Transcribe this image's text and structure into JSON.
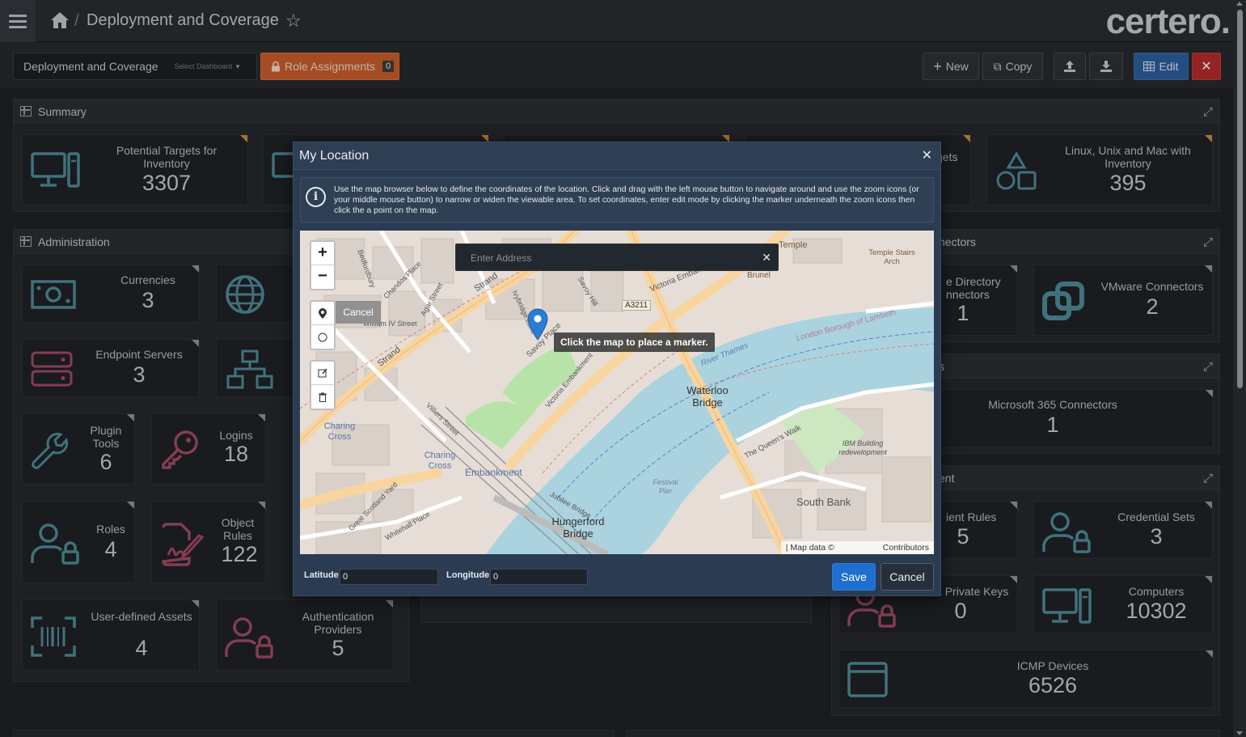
{
  "topbar": {
    "page_title": "Deployment and Coverage",
    "brand": "certero."
  },
  "toolbar": {
    "dashboard_name": "Deployment and Coverage",
    "dashboard_select": "Select Dashboard",
    "role_label": "Role Assignments",
    "role_count": "0",
    "new_label": "New",
    "copy_label": "Copy",
    "edit_label": "Edit",
    "close_label": "✕"
  },
  "summary": {
    "title": "Summary",
    "tiles": [
      {
        "label": "Potential Targets for Inventory",
        "value": "3307",
        "icon": "monitor-tower-icon"
      },
      {
        "label": "gets",
        "value": "",
        "icon": "monitor-icon"
      },
      {
        "label": "Linux, Unix and Mac with Inventory",
        "value": "395",
        "icon": "shapes-icon"
      }
    ]
  },
  "administration": {
    "title": "Administration",
    "tiles": [
      {
        "label": "Currencies",
        "value": "3",
        "icon": "banknote-icon"
      },
      {
        "label": "",
        "value": "",
        "icon": "globe-icon"
      },
      {
        "label": "Endpoint Servers",
        "value": "3",
        "icon": "servers-icon"
      },
      {
        "label": "",
        "value": "",
        "icon": "network-icon"
      },
      {
        "label": "Plugin Tools",
        "value": "6",
        "icon": "wrench-icon"
      },
      {
        "label": "Logins",
        "value": "18",
        "icon": "key-icon"
      },
      {
        "label": "Roles",
        "value": "4",
        "icon": "user-lock-icon"
      },
      {
        "label": "Object Rules",
        "value": "122",
        "icon": "file-signature-icon"
      },
      {
        "label": "User-defined Assets",
        "value": "4",
        "icon": "barcode-icon"
      },
      {
        "label": "Authentication Providers",
        "value": "5",
        "icon": "user-lock-icon"
      }
    ]
  },
  "connectors": {
    "title": "nectors",
    "tiles": [
      {
        "label": "e Directory nnectors",
        "value": "1"
      },
      {
        "label": "VMware Connectors",
        "value": "2",
        "icon": "vmware-icon"
      }
    ]
  },
  "ms_section": {
    "title": "s",
    "tiles": [
      {
        "label": "Microsoft 365 Connectors",
        "value": "1"
      }
    ]
  },
  "management": {
    "title": "ent",
    "tiles": [
      {
        "label": "ient Rules",
        "value": "5"
      },
      {
        "label": "Credential Sets",
        "value": "3",
        "icon": "user-lock-icon"
      },
      {
        "label": "Private Keys",
        "value": "0",
        "icon": "user-lock-icon"
      },
      {
        "label": "Computers",
        "value": "10302",
        "icon": "monitor-tower-icon"
      },
      {
        "label": "ICMP Devices",
        "value": "6526",
        "icon": "window-icon"
      }
    ]
  },
  "modal": {
    "title": "My Location",
    "info": "Use the map browser below to define the coordinates of the location. Click and drag with the left mouse button to navigate around and use the zoom icons (or your middle mouse button) to narrow or widen the viewable area. To set coordinates, enter edit mode by clicking the marker underneath the zoom icons then click the a point on the map.",
    "address_placeholder": "Enter Address",
    "cancel_tip": "Cancel",
    "marker_tip": "Click the map to place a marker.",
    "attribution_left": "| Map data ©",
    "attribution_right": "Contributors",
    "latitude_label": "Latitude",
    "latitude_value": "0",
    "longitude_label": "Longitude",
    "longitude_value": "0",
    "save_label": "Save",
    "cancel_label": "Cancel"
  },
  "map_labels": {
    "strand": "Strand",
    "strand2": "Strand",
    "savoy_place": "Savoy Place",
    "savoy_hill": "Savoy Hill",
    "william_iv": "William IV Street",
    "a3211": "A3211",
    "victoria_emb": "Victoria Embankment",
    "victoria_emb2": "Victoria Embankment",
    "temple": "Temple",
    "temple_stairs": "Temple Stairs Arch",
    "brunel": "Brunel",
    "river_thames": "River Thames",
    "lambeth": "London Borough of Lambeth",
    "waterloo_bridge": "Waterloo Bridge",
    "charing_cross": "Charing Cross",
    "charing_cross2": "Charing Cross",
    "embankment": "Embankment",
    "villiers": "Villiers Street",
    "hungerford": "Hungerford Bridge",
    "jubilee": "Jubilee Bridge",
    "festival_pier": "Festival Pier",
    "queens_walk": "The Queen's Walk",
    "ibm": "IBM Building redevelopment",
    "south_bank": "South Bank",
    "great_scotland": "Great Scotland Yard",
    "whitehall": "Whitehall Place",
    "chandos": "Chandos Place",
    "bedfordbury": "Bedfordbury",
    "agar": "Agar Street",
    "ivybridge": "Ivybridge Lane"
  }
}
